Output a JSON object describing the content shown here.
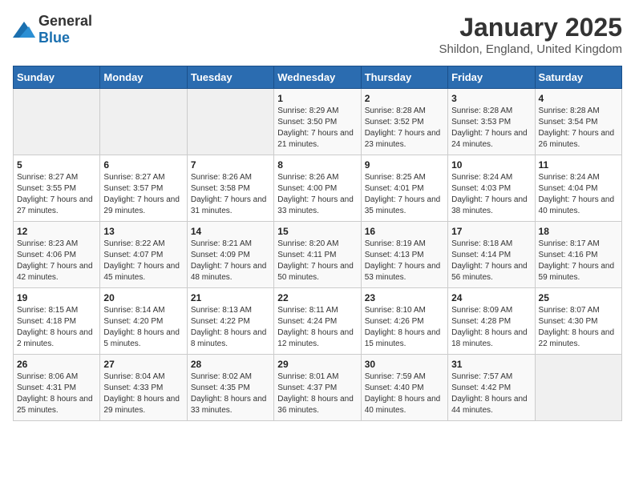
{
  "logo": {
    "general": "General",
    "blue": "Blue"
  },
  "header": {
    "title": "January 2025",
    "subtitle": "Shildon, England, United Kingdom"
  },
  "weekdays": [
    "Sunday",
    "Monday",
    "Tuesday",
    "Wednesday",
    "Thursday",
    "Friday",
    "Saturday"
  ],
  "weeks": [
    [
      {
        "day": "",
        "info": ""
      },
      {
        "day": "",
        "info": ""
      },
      {
        "day": "",
        "info": ""
      },
      {
        "day": "1",
        "info": "Sunrise: 8:29 AM\nSunset: 3:50 PM\nDaylight: 7 hours and 21 minutes."
      },
      {
        "day": "2",
        "info": "Sunrise: 8:28 AM\nSunset: 3:52 PM\nDaylight: 7 hours and 23 minutes."
      },
      {
        "day": "3",
        "info": "Sunrise: 8:28 AM\nSunset: 3:53 PM\nDaylight: 7 hours and 24 minutes."
      },
      {
        "day": "4",
        "info": "Sunrise: 8:28 AM\nSunset: 3:54 PM\nDaylight: 7 hours and 26 minutes."
      }
    ],
    [
      {
        "day": "5",
        "info": "Sunrise: 8:27 AM\nSunset: 3:55 PM\nDaylight: 7 hours and 27 minutes."
      },
      {
        "day": "6",
        "info": "Sunrise: 8:27 AM\nSunset: 3:57 PM\nDaylight: 7 hours and 29 minutes."
      },
      {
        "day": "7",
        "info": "Sunrise: 8:26 AM\nSunset: 3:58 PM\nDaylight: 7 hours and 31 minutes."
      },
      {
        "day": "8",
        "info": "Sunrise: 8:26 AM\nSunset: 4:00 PM\nDaylight: 7 hours and 33 minutes."
      },
      {
        "day": "9",
        "info": "Sunrise: 8:25 AM\nSunset: 4:01 PM\nDaylight: 7 hours and 35 minutes."
      },
      {
        "day": "10",
        "info": "Sunrise: 8:24 AM\nSunset: 4:03 PM\nDaylight: 7 hours and 38 minutes."
      },
      {
        "day": "11",
        "info": "Sunrise: 8:24 AM\nSunset: 4:04 PM\nDaylight: 7 hours and 40 minutes."
      }
    ],
    [
      {
        "day": "12",
        "info": "Sunrise: 8:23 AM\nSunset: 4:06 PM\nDaylight: 7 hours and 42 minutes."
      },
      {
        "day": "13",
        "info": "Sunrise: 8:22 AM\nSunset: 4:07 PM\nDaylight: 7 hours and 45 minutes."
      },
      {
        "day": "14",
        "info": "Sunrise: 8:21 AM\nSunset: 4:09 PM\nDaylight: 7 hours and 48 minutes."
      },
      {
        "day": "15",
        "info": "Sunrise: 8:20 AM\nSunset: 4:11 PM\nDaylight: 7 hours and 50 minutes."
      },
      {
        "day": "16",
        "info": "Sunrise: 8:19 AM\nSunset: 4:13 PM\nDaylight: 7 hours and 53 minutes."
      },
      {
        "day": "17",
        "info": "Sunrise: 8:18 AM\nSunset: 4:14 PM\nDaylight: 7 hours and 56 minutes."
      },
      {
        "day": "18",
        "info": "Sunrise: 8:17 AM\nSunset: 4:16 PM\nDaylight: 7 hours and 59 minutes."
      }
    ],
    [
      {
        "day": "19",
        "info": "Sunrise: 8:15 AM\nSunset: 4:18 PM\nDaylight: 8 hours and 2 minutes."
      },
      {
        "day": "20",
        "info": "Sunrise: 8:14 AM\nSunset: 4:20 PM\nDaylight: 8 hours and 5 minutes."
      },
      {
        "day": "21",
        "info": "Sunrise: 8:13 AM\nSunset: 4:22 PM\nDaylight: 8 hours and 8 minutes."
      },
      {
        "day": "22",
        "info": "Sunrise: 8:11 AM\nSunset: 4:24 PM\nDaylight: 8 hours and 12 minutes."
      },
      {
        "day": "23",
        "info": "Sunrise: 8:10 AM\nSunset: 4:26 PM\nDaylight: 8 hours and 15 minutes."
      },
      {
        "day": "24",
        "info": "Sunrise: 8:09 AM\nSunset: 4:28 PM\nDaylight: 8 hours and 18 minutes."
      },
      {
        "day": "25",
        "info": "Sunrise: 8:07 AM\nSunset: 4:30 PM\nDaylight: 8 hours and 22 minutes."
      }
    ],
    [
      {
        "day": "26",
        "info": "Sunrise: 8:06 AM\nSunset: 4:31 PM\nDaylight: 8 hours and 25 minutes."
      },
      {
        "day": "27",
        "info": "Sunrise: 8:04 AM\nSunset: 4:33 PM\nDaylight: 8 hours and 29 minutes."
      },
      {
        "day": "28",
        "info": "Sunrise: 8:02 AM\nSunset: 4:35 PM\nDaylight: 8 hours and 33 minutes."
      },
      {
        "day": "29",
        "info": "Sunrise: 8:01 AM\nSunset: 4:37 PM\nDaylight: 8 hours and 36 minutes."
      },
      {
        "day": "30",
        "info": "Sunrise: 7:59 AM\nSunset: 4:40 PM\nDaylight: 8 hours and 40 minutes."
      },
      {
        "day": "31",
        "info": "Sunrise: 7:57 AM\nSunset: 4:42 PM\nDaylight: 8 hours and 44 minutes."
      },
      {
        "day": "",
        "info": ""
      }
    ]
  ]
}
